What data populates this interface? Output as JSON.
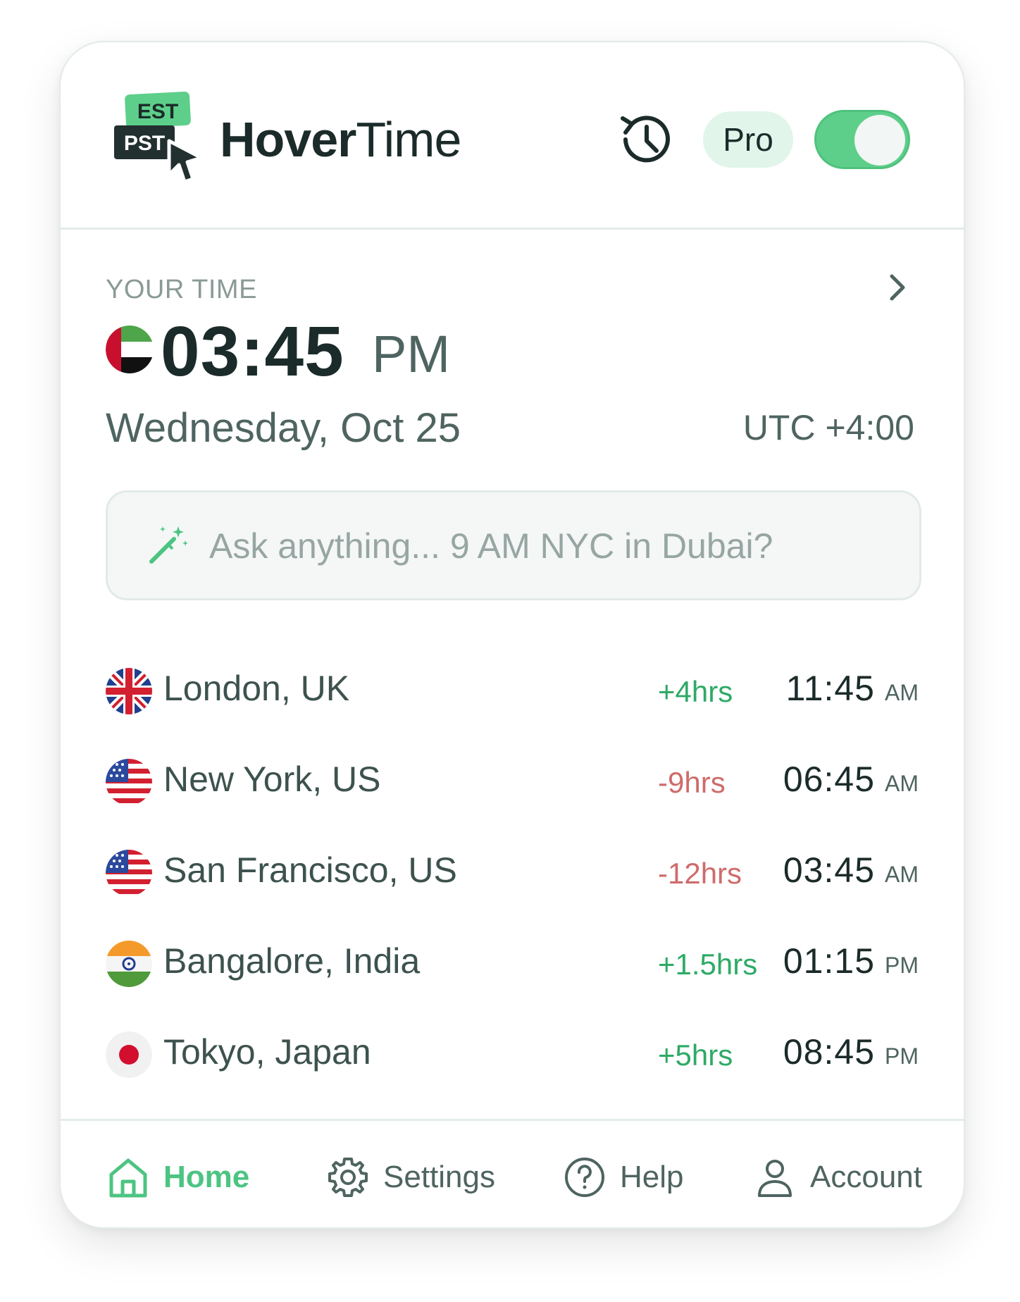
{
  "app": {
    "logo_badge_top": "EST",
    "logo_badge_bottom": "PST",
    "brand_bold": "Hover",
    "brand_light": "Time",
    "pro_label": "Pro",
    "toggle_on": true,
    "accent_color": "#5dcf8a"
  },
  "your_time": {
    "label": "YOUR TIME",
    "time": "03:45",
    "ampm": "PM",
    "date": "Wednesday, Oct 25",
    "utc": "UTC +4:00",
    "flag_icon": "uae-flag-icon"
  },
  "search": {
    "placeholder": "Ask anything... 9 AM NYC in Dubai?",
    "value": ""
  },
  "cities": [
    {
      "name": "London, UK",
      "offset": "+4hrs",
      "time": "11:45",
      "ampm": "AM",
      "flag": "uk-flag-icon"
    },
    {
      "name": "New York, US",
      "offset": "-9hrs",
      "time": "06:45",
      "ampm": "AM",
      "flag": "us-flag-icon"
    },
    {
      "name": "San Francisco, US",
      "offset": "-12hrs",
      "time": "03:45",
      "ampm": "AM",
      "flag": "us-flag-icon"
    },
    {
      "name": "Bangalore, India",
      "offset": "+1.5hrs",
      "time": "01:15",
      "ampm": "PM",
      "flag": "india-flag-icon"
    },
    {
      "name": "Tokyo, Japan",
      "offset": "+5hrs",
      "time": "08:45",
      "ampm": "PM",
      "flag": "japan-flag-icon"
    }
  ],
  "nav": {
    "home": "Home",
    "settings": "Settings",
    "help": "Help",
    "account": "Account",
    "active": "home"
  }
}
